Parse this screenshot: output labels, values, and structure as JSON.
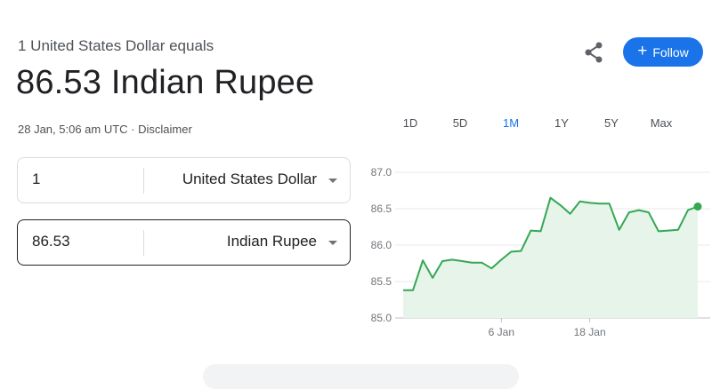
{
  "header": {
    "equals_text": "1 United States Dollar equals",
    "rate_text": "86.53 Indian Rupee",
    "timestamp": "28 Jan, 5:06 am UTC",
    "separator": " · ",
    "disclaimer": "Disclaimer"
  },
  "actions": {
    "share_icon": "share-icon",
    "follow_label": "Follow",
    "follow_plus": "+",
    "follow_color": "#1a73e8"
  },
  "converter": {
    "from": {
      "amount": "1",
      "currency": "United States Dollar"
    },
    "to": {
      "amount": "86.53",
      "currency": "Indian Rupee"
    }
  },
  "ranges": [
    "1D",
    "5D",
    "1M",
    "1Y",
    "5Y",
    "Max"
  ],
  "active_range": "1M",
  "chart_data": {
    "type": "area",
    "line_color": "#34a853",
    "fill_color": "#e6f4ea",
    "ylim": [
      85.0,
      87.0
    ],
    "yticks": [
      85.0,
      85.5,
      86.0,
      86.5,
      87.0
    ],
    "ytick_labels": [
      "85.0",
      "85.5",
      "86.0",
      "86.5",
      "87.0"
    ],
    "grid": true,
    "x_tick_labels": [
      {
        "label": "6 Jan",
        "index": 10
      },
      {
        "label": "18 Jan",
        "index": 19
      }
    ],
    "series": [
      {
        "values": [
          85.38,
          85.38,
          85.79,
          85.55,
          85.78,
          85.8,
          85.78,
          85.76,
          85.76,
          85.68,
          85.8,
          85.91,
          85.92,
          86.2,
          86.19,
          86.65,
          86.55,
          86.43,
          86.6,
          86.58,
          86.57,
          86.57,
          86.21,
          86.45,
          86.48,
          86.45,
          86.19,
          86.2,
          86.21,
          86.48,
          86.53
        ]
      }
    ]
  }
}
